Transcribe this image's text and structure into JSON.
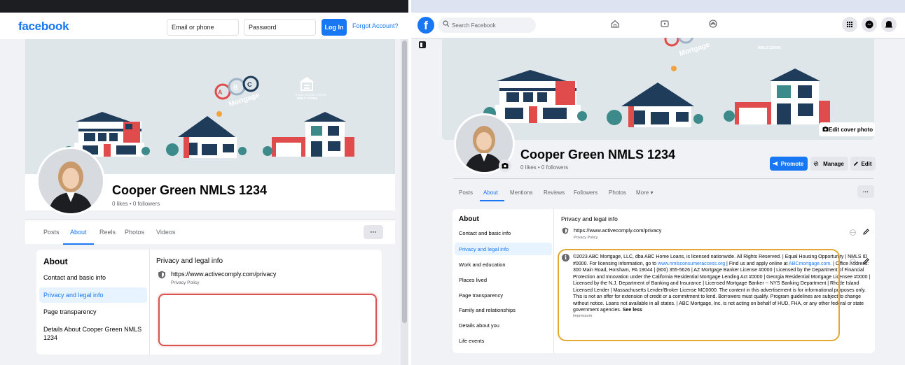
{
  "left": {
    "logo": "facebook",
    "login": {
      "email_placeholder": "Email or phone",
      "password_placeholder": "Password",
      "login_label": "Log In",
      "forgot_label": "Forgot Account?"
    },
    "cover": {
      "brand_word": "Mortgage",
      "letters": [
        "A",
        "B",
        "C"
      ],
      "housing_label": "EQUAL HOUSING LENDER",
      "nmls": "NMLS 123456"
    },
    "profile": {
      "name": "Cooper Green NMLS 1234",
      "stats": "0 likes • 0 followers"
    },
    "tabs": [
      "Posts",
      "About",
      "Reels",
      "Photos",
      "Videos"
    ],
    "active_tab": "About",
    "more_label": "···",
    "about": {
      "title": "About",
      "items": [
        "Contact and basic info",
        "Privacy and legal info",
        "Page transparency",
        "Details About Cooper Green NMLS 1234"
      ],
      "active_item": "Privacy and legal info"
    },
    "section": {
      "title": "Privacy and legal info",
      "privacy_url": "https://www.activecomply.com/privacy",
      "privacy_label": "Privacy Policy"
    },
    "highlight_color": "#d9534f"
  },
  "right": {
    "search_placeholder": "Search Facebook",
    "cover": {
      "brand_word": "Mortgage",
      "nmls": "NMLS 123456",
      "edit_cover_label": "Edit cover photo"
    },
    "profile": {
      "name": "Cooper Green NMLS 1234",
      "stats": "0 likes • 0 followers"
    },
    "actions": {
      "promote": "Promote",
      "manage": "Manage",
      "edit": "Edit"
    },
    "tabs": [
      "Posts",
      "About",
      "Mentions",
      "Reviews",
      "Followers",
      "Photos",
      "More ▾"
    ],
    "active_tab": "About",
    "more_label": "···",
    "about": {
      "title": "About",
      "items": [
        "Contact and basic info",
        "Privacy and legal info",
        "Work and education",
        "Places lived",
        "Page transparency",
        "Family and relationships",
        "Details about you",
        "Life events"
      ],
      "active_item": "Privacy and legal info"
    },
    "section": {
      "title": "Privacy and legal info",
      "privacy_url": "https://www.activecomply.com/privacy",
      "privacy_label": "Privacy Policy",
      "disclosure_part1": "©2023 ABC Mortgage, LLC, dba ABC Home Loans, is licensed nationwide. All Rights Reserved. | Equal Housing Opportunity | NMLS ID #0000. For licensing information, go to ",
      "disclosure_link1": "www.nmlsconsumeraccess.org",
      "disclosure_part2": " | Find us and apply online at ",
      "disclosure_link2": "ABCmortgage.com.",
      "disclosure_part3": " | Office Address: 300 Main Road, Horsham, PA 19044 | (800) 355-5626 | AZ Mortgage Banker License #0000 | Licensed by the Department of Financial Protection and Innovation under the California Residential Mortgage Lending Act #0000 | Georgia Residential Mortgage Licensee #0000 | Licensed by the N.J. Department of Banking and Insurance | Licensed Mortgage Banker -- NYS Banking Department | Rhode Island Licensed Lender | Massachusetts Lender/Broker License MC0000.  The content in this advertisement is for informational purposes only. This is not an offer for extension of credit or a commitment to lend. Borrowers must qualify. Program guidelines are subject to change without notice. Loans not available in all states. | ABC Mortgage, Inc. is not acting on behalf of HUD, FHA, or any other federal or state government agencies. ",
      "see_less": "See less",
      "impressum": "Impressum"
    },
    "highlight_color": "#e3a930"
  },
  "colors": {
    "fb_blue": "#1877f2",
    "page_bg": "#f0f2f5",
    "house_red": "#e04b4b",
    "house_navy": "#1f3c5a",
    "tree_teal": "#3c8a8a"
  }
}
